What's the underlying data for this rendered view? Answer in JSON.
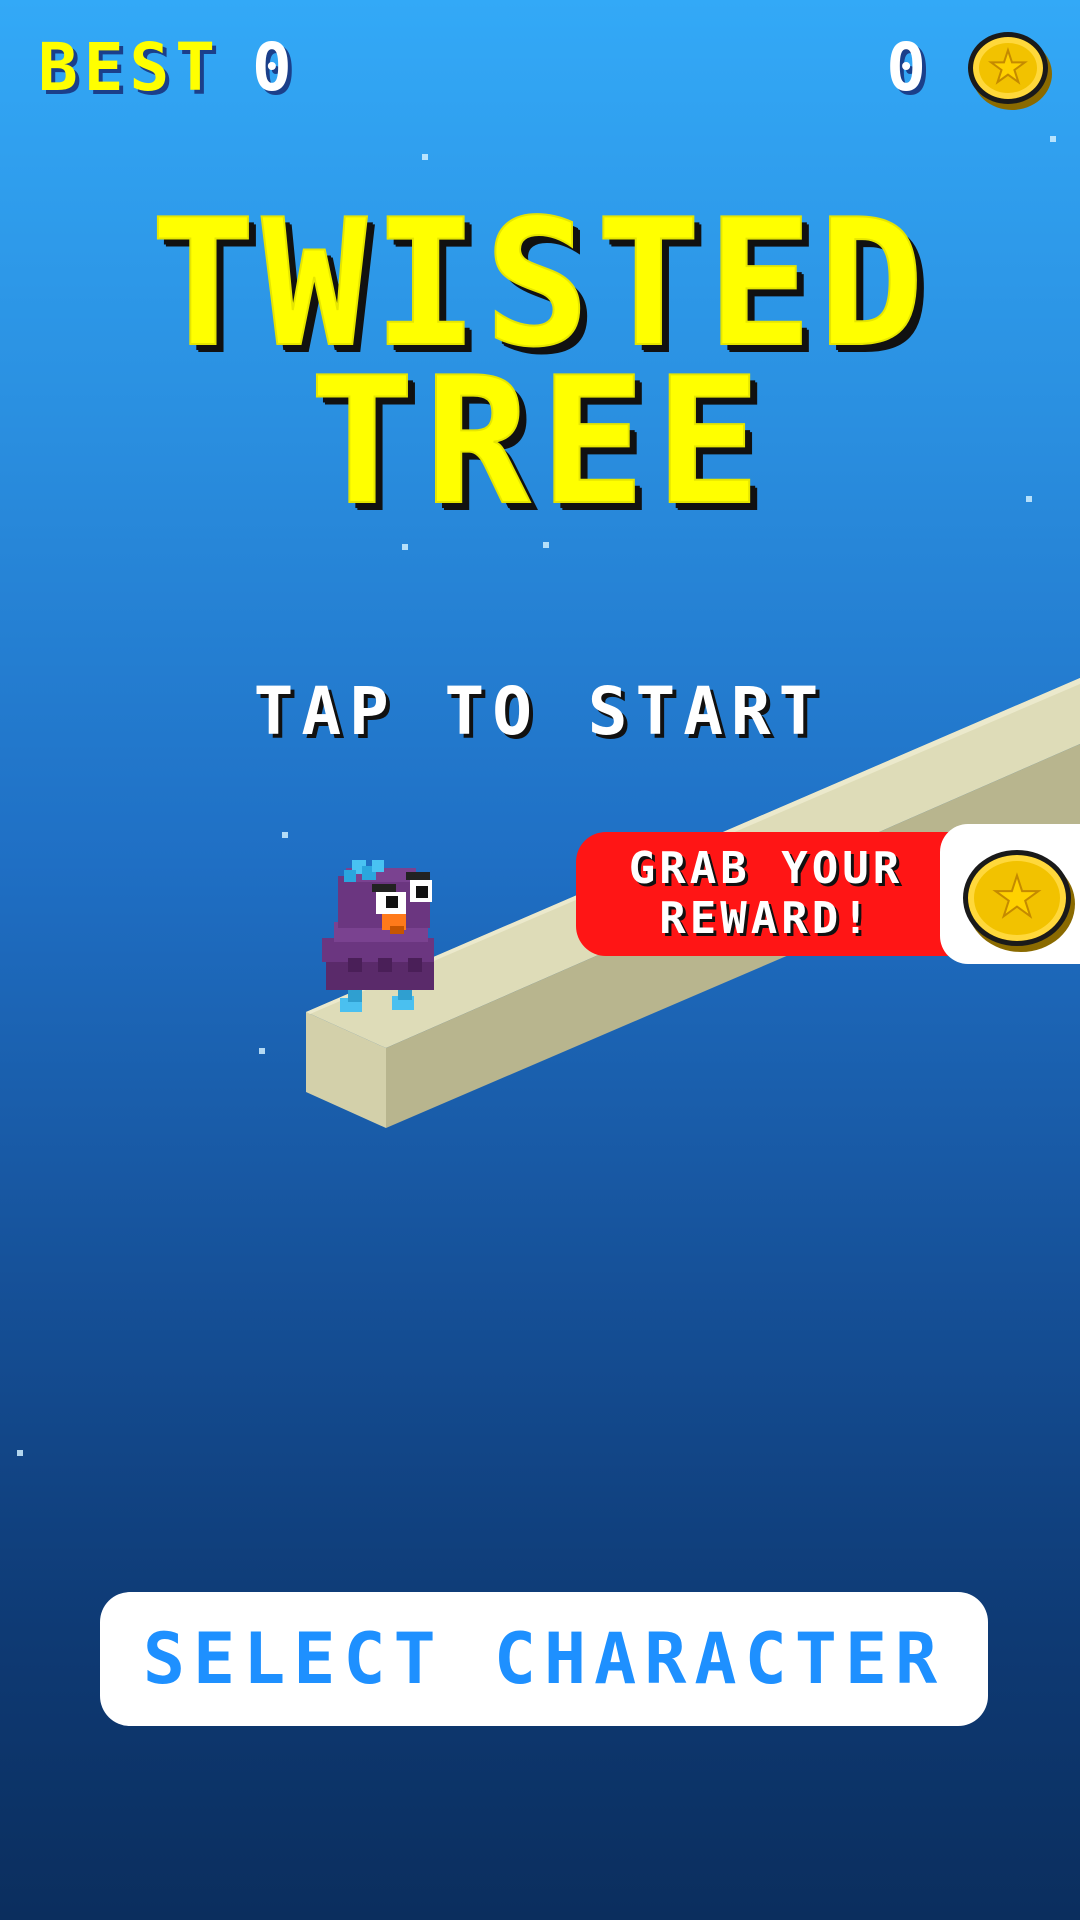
{
  "hud": {
    "best_label": "BEST",
    "best_value": "0",
    "coins_value": "0",
    "coin_icon": "star-coin-icon"
  },
  "title": {
    "line1": "TWISTED",
    "line2": "TREE"
  },
  "prompt": {
    "tap_to_start": "TAP TO START"
  },
  "reward": {
    "line1": "GRAB YOUR",
    "line2": "REWARD!",
    "coin_icon": "star-coin-icon"
  },
  "buttons": {
    "select_character": "SELECT CHARACTER"
  },
  "colors": {
    "sky_top": "#33a9f7",
    "sky_bottom": "#0b2e5e",
    "title_yellow": "#ffff00",
    "reward_red": "#ff1515",
    "button_text_blue": "#1e90ff",
    "coin_gold": "#f2c200"
  }
}
